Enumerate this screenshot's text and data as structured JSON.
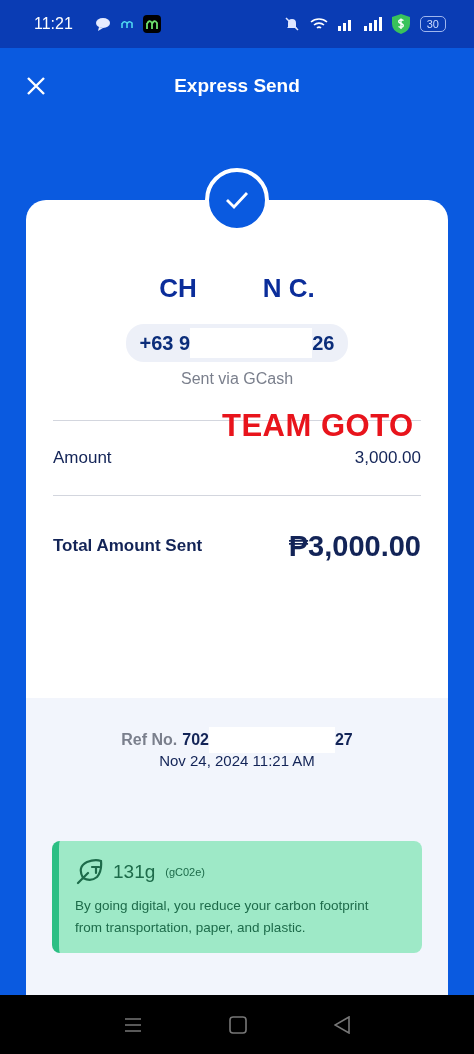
{
  "status_bar": {
    "time": "11:21",
    "battery": "30"
  },
  "header": {
    "title": "Express Send"
  },
  "recipient": {
    "name_parts": [
      "CH",
      "N C."
    ],
    "phone_parts": [
      "+63 9",
      "26"
    ],
    "via": "Sent via GCash"
  },
  "overlay_label": "TEAM GOTO",
  "rows": [
    {
      "label": "Amount",
      "value": "3,000.00",
      "kind": "plain"
    },
    {
      "label": "Total Amount Sent",
      "value": "₱3,000.00",
      "kind": "total"
    }
  ],
  "reference": {
    "label": "Ref No.",
    "value_parts": [
      "702",
      "27"
    ],
    "datetime": "Nov 24, 2024 11:21 AM"
  },
  "carbon": {
    "amount": "131g",
    "unit": "(gC02e)",
    "message": "By going digital, you reduce your carbon footprint from transportation, paper, and plastic."
  }
}
